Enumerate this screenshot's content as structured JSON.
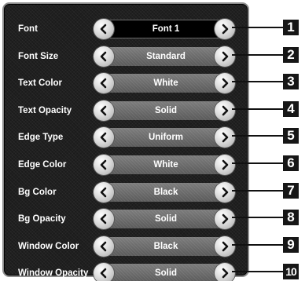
{
  "options": [
    {
      "label": "Font",
      "value": "Font 1",
      "number": "1"
    },
    {
      "label": "Font Size",
      "value": "Standard",
      "number": "2"
    },
    {
      "label": "Text Color",
      "value": "White",
      "number": "3"
    },
    {
      "label": "Text Opacity",
      "value": "Solid",
      "number": "4"
    },
    {
      "label": "Edge Type",
      "value": "Uniform",
      "number": "5"
    },
    {
      "label": "Edge Color",
      "value": "White",
      "number": "6"
    },
    {
      "label": "Bg Color",
      "value": "Black",
      "number": "7"
    },
    {
      "label": "Bg Opacity",
      "value": "Solid",
      "number": "8"
    },
    {
      "label": "Window Color",
      "value": "Black",
      "number": "9"
    },
    {
      "label": "Window Opacity",
      "value": "Solid",
      "number": "10"
    }
  ],
  "selected_index": 0,
  "icons": {
    "previous": "chevron-left-icon",
    "next": "chevron-right-icon"
  }
}
